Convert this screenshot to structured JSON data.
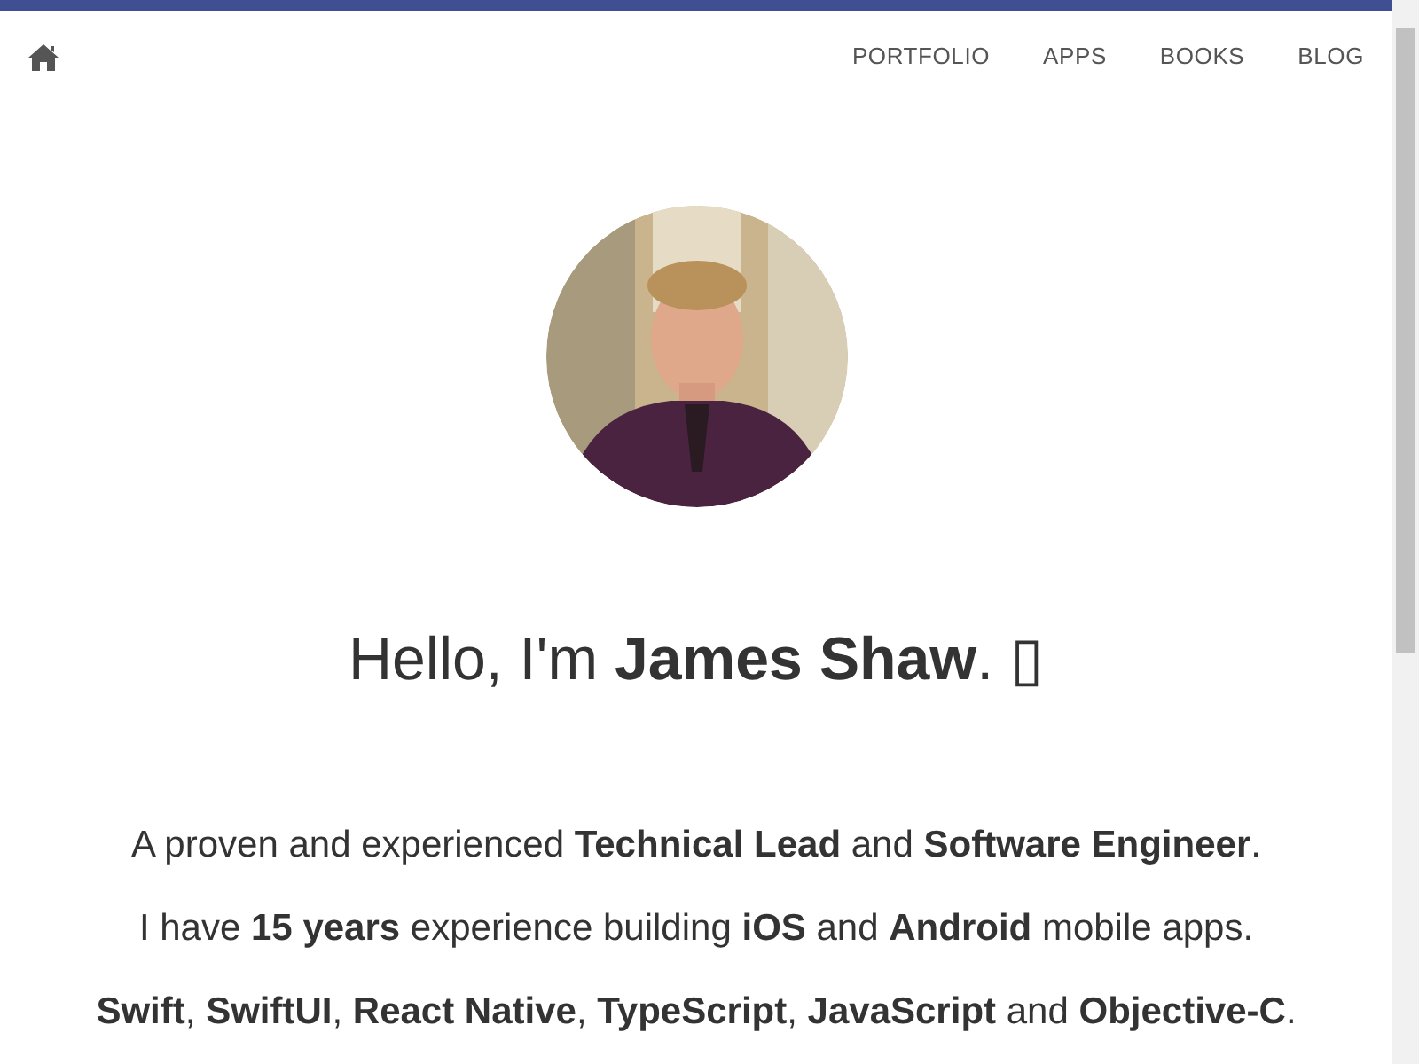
{
  "nav": {
    "links": [
      {
        "label": "PORTFOLIO"
      },
      {
        "label": "APPS"
      },
      {
        "label": "BOOKS"
      },
      {
        "label": "BLOG"
      }
    ]
  },
  "avatar": {
    "kind": "picture"
  },
  "heading": "Hello, I'm **James Shaw**. ▯",
  "intro": [
    "A proven and experienced **Technical Lead** and **Software Engineer**.",
    "I have **15 years** experience building **iOS** and **Android** mobile apps.",
    "**Swift**, **SwiftUI**, **React Native**, **TypeScript**, **JavaScript** and **Objective-C**."
  ]
}
